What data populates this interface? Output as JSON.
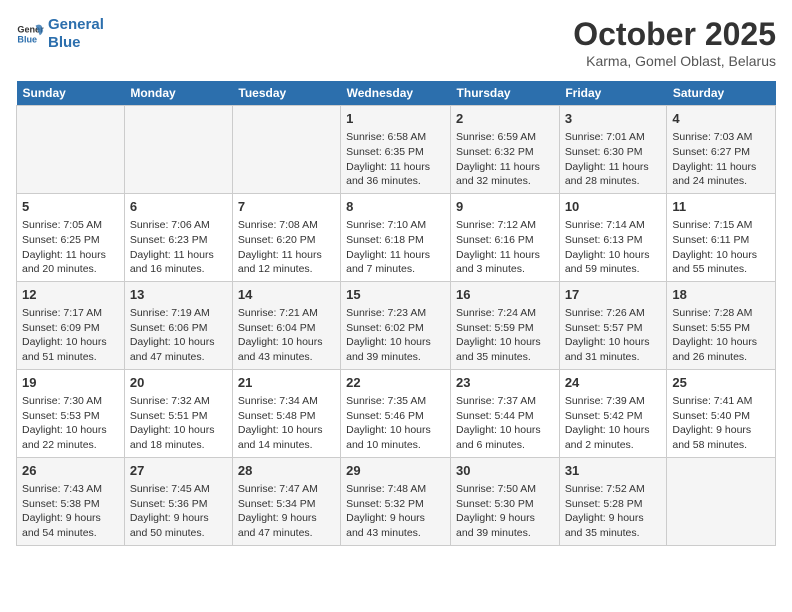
{
  "logo": {
    "line1": "General",
    "line2": "Blue"
  },
  "title": "October 2025",
  "subtitle": "Karma, Gomel Oblast, Belarus",
  "days_of_week": [
    "Sunday",
    "Monday",
    "Tuesday",
    "Wednesday",
    "Thursday",
    "Friday",
    "Saturday"
  ],
  "weeks": [
    [
      {
        "day": "",
        "content": ""
      },
      {
        "day": "",
        "content": ""
      },
      {
        "day": "",
        "content": ""
      },
      {
        "day": "1",
        "content": "Sunrise: 6:58 AM\nSunset: 6:35 PM\nDaylight: 11 hours and 36 minutes."
      },
      {
        "day": "2",
        "content": "Sunrise: 6:59 AM\nSunset: 6:32 PM\nDaylight: 11 hours and 32 minutes."
      },
      {
        "day": "3",
        "content": "Sunrise: 7:01 AM\nSunset: 6:30 PM\nDaylight: 11 hours and 28 minutes."
      },
      {
        "day": "4",
        "content": "Sunrise: 7:03 AM\nSunset: 6:27 PM\nDaylight: 11 hours and 24 minutes."
      }
    ],
    [
      {
        "day": "5",
        "content": "Sunrise: 7:05 AM\nSunset: 6:25 PM\nDaylight: 11 hours and 20 minutes."
      },
      {
        "day": "6",
        "content": "Sunrise: 7:06 AM\nSunset: 6:23 PM\nDaylight: 11 hours and 16 minutes."
      },
      {
        "day": "7",
        "content": "Sunrise: 7:08 AM\nSunset: 6:20 PM\nDaylight: 11 hours and 12 minutes."
      },
      {
        "day": "8",
        "content": "Sunrise: 7:10 AM\nSunset: 6:18 PM\nDaylight: 11 hours and 7 minutes."
      },
      {
        "day": "9",
        "content": "Sunrise: 7:12 AM\nSunset: 6:16 PM\nDaylight: 11 hours and 3 minutes."
      },
      {
        "day": "10",
        "content": "Sunrise: 7:14 AM\nSunset: 6:13 PM\nDaylight: 10 hours and 59 minutes."
      },
      {
        "day": "11",
        "content": "Sunrise: 7:15 AM\nSunset: 6:11 PM\nDaylight: 10 hours and 55 minutes."
      }
    ],
    [
      {
        "day": "12",
        "content": "Sunrise: 7:17 AM\nSunset: 6:09 PM\nDaylight: 10 hours and 51 minutes."
      },
      {
        "day": "13",
        "content": "Sunrise: 7:19 AM\nSunset: 6:06 PM\nDaylight: 10 hours and 47 minutes."
      },
      {
        "day": "14",
        "content": "Sunrise: 7:21 AM\nSunset: 6:04 PM\nDaylight: 10 hours and 43 minutes."
      },
      {
        "day": "15",
        "content": "Sunrise: 7:23 AM\nSunset: 6:02 PM\nDaylight: 10 hours and 39 minutes."
      },
      {
        "day": "16",
        "content": "Sunrise: 7:24 AM\nSunset: 5:59 PM\nDaylight: 10 hours and 35 minutes."
      },
      {
        "day": "17",
        "content": "Sunrise: 7:26 AM\nSunset: 5:57 PM\nDaylight: 10 hours and 31 minutes."
      },
      {
        "day": "18",
        "content": "Sunrise: 7:28 AM\nSunset: 5:55 PM\nDaylight: 10 hours and 26 minutes."
      }
    ],
    [
      {
        "day": "19",
        "content": "Sunrise: 7:30 AM\nSunset: 5:53 PM\nDaylight: 10 hours and 22 minutes."
      },
      {
        "day": "20",
        "content": "Sunrise: 7:32 AM\nSunset: 5:51 PM\nDaylight: 10 hours and 18 minutes."
      },
      {
        "day": "21",
        "content": "Sunrise: 7:34 AM\nSunset: 5:48 PM\nDaylight: 10 hours and 14 minutes."
      },
      {
        "day": "22",
        "content": "Sunrise: 7:35 AM\nSunset: 5:46 PM\nDaylight: 10 hours and 10 minutes."
      },
      {
        "day": "23",
        "content": "Sunrise: 7:37 AM\nSunset: 5:44 PM\nDaylight: 10 hours and 6 minutes."
      },
      {
        "day": "24",
        "content": "Sunrise: 7:39 AM\nSunset: 5:42 PM\nDaylight: 10 hours and 2 minutes."
      },
      {
        "day": "25",
        "content": "Sunrise: 7:41 AM\nSunset: 5:40 PM\nDaylight: 9 hours and 58 minutes."
      }
    ],
    [
      {
        "day": "26",
        "content": "Sunrise: 7:43 AM\nSunset: 5:38 PM\nDaylight: 9 hours and 54 minutes."
      },
      {
        "day": "27",
        "content": "Sunrise: 7:45 AM\nSunset: 5:36 PM\nDaylight: 9 hours and 50 minutes."
      },
      {
        "day": "28",
        "content": "Sunrise: 7:47 AM\nSunset: 5:34 PM\nDaylight: 9 hours and 47 minutes."
      },
      {
        "day": "29",
        "content": "Sunrise: 7:48 AM\nSunset: 5:32 PM\nDaylight: 9 hours and 43 minutes."
      },
      {
        "day": "30",
        "content": "Sunrise: 7:50 AM\nSunset: 5:30 PM\nDaylight: 9 hours and 39 minutes."
      },
      {
        "day": "31",
        "content": "Sunrise: 7:52 AM\nSunset: 5:28 PM\nDaylight: 9 hours and 35 minutes."
      },
      {
        "day": "",
        "content": ""
      }
    ]
  ]
}
